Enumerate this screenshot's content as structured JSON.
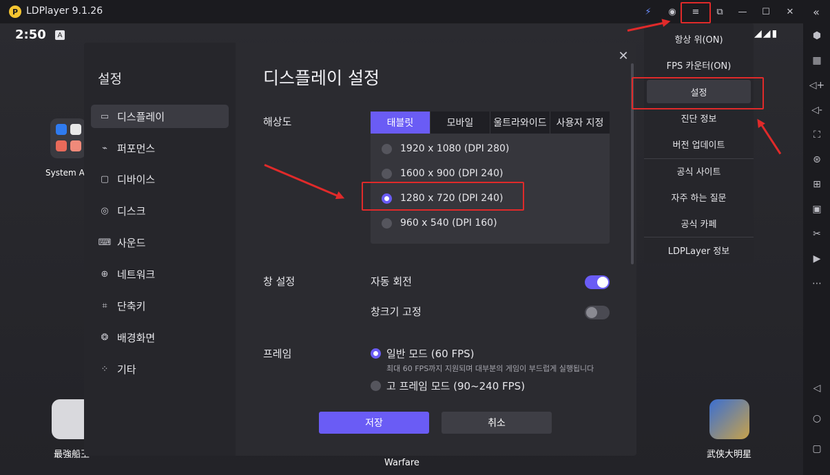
{
  "titlebar": {
    "title": "LDPlayer 9.1.26",
    "logo_text": "P"
  },
  "status": {
    "time": "2:50",
    "a_badge": "A",
    "signal": "◢◢▮"
  },
  "home": {
    "system_apps_label": "System Ap",
    "dock": [
      {
        "label": "最強船王"
      },
      {
        "label": "Warfare"
      },
      {
        "label": "武侠大明星"
      }
    ]
  },
  "settings": {
    "sidebar_title": "설정",
    "sidebar": [
      {
        "label": "디스플레이",
        "icon": "monitor-icon",
        "glyph": "▭"
      },
      {
        "label": "퍼포먼스",
        "icon": "performance-icon",
        "glyph": "⌁"
      },
      {
        "label": "디바이스",
        "icon": "device-icon",
        "glyph": "▢"
      },
      {
        "label": "디스크",
        "icon": "disk-icon",
        "glyph": "◎"
      },
      {
        "label": "사운드",
        "icon": "gamepad-icon",
        "glyph": "⌨"
      },
      {
        "label": "네트워크",
        "icon": "globe-icon",
        "glyph": "⊕"
      },
      {
        "label": "단축키",
        "icon": "keyboard-icon",
        "glyph": "⌗"
      },
      {
        "label": "배경화면",
        "icon": "palette-icon",
        "glyph": "❂"
      },
      {
        "label": "기타",
        "icon": "grid-icon",
        "glyph": "⁘"
      }
    ],
    "title": "디스플레이 설정",
    "close_glyph": "✕",
    "resolution": {
      "label": "해상도",
      "tabs": [
        {
          "label": "태블릿",
          "active": true
        },
        {
          "label": "모바일",
          "active": false
        },
        {
          "label": "울트라와이드",
          "active": false
        },
        {
          "label": "사용자 지정",
          "active": false
        }
      ],
      "options": [
        {
          "label": "1920 x 1080  (DPI 280)",
          "selected": false
        },
        {
          "label": "1600 x 900  (DPI 240)",
          "selected": false
        },
        {
          "label": "1280 x 720  (DPI 240)",
          "selected": true
        },
        {
          "label": "960 x 540  (DPI 160)",
          "selected": false
        }
      ]
    },
    "window": {
      "label": "창 설정",
      "auto_rotate": {
        "label": "자동 회전",
        "on": true
      },
      "fix_size": {
        "label": "창크기 고정",
        "on": false
      }
    },
    "frame": {
      "label": "프레임",
      "normal": {
        "label": "일반 모드 (60 FPS)",
        "selected": true
      },
      "normal_desc": "최대 60 FPS까지 지원되며 대부분의 게임이 부드럽게 실행됩니다",
      "high": {
        "label": "고 프레임 모드 (90~240 FPS)",
        "selected": false
      }
    },
    "save_label": "저장",
    "cancel_label": "취소"
  },
  "menu": {
    "items": [
      {
        "label": "항상 위(ON)"
      },
      {
        "label": "FPS 카운터(ON)"
      },
      {
        "label": "설정"
      },
      {
        "label": "진단 정보"
      },
      {
        "label": "버전 업데이트"
      },
      {
        "label": "공식 사이트"
      },
      {
        "label": "자주 하는 질문"
      },
      {
        "label": "공식 카페"
      },
      {
        "label": "LDPLayer 정보"
      }
    ]
  },
  "titlebar_icons": [
    {
      "name": "bolt-icon",
      "glyph": "⚡"
    },
    {
      "name": "account-icon",
      "glyph": "◉"
    },
    {
      "name": "menu-icon",
      "glyph": "≡"
    },
    {
      "name": "popout-icon",
      "glyph": "⧉"
    },
    {
      "name": "minimize-icon",
      "glyph": "—"
    },
    {
      "name": "maximize-icon",
      "glyph": "☐"
    },
    {
      "name": "close-icon",
      "glyph": "✕"
    },
    {
      "name": "collapse-icon",
      "glyph": "«"
    }
  ],
  "rail_icons": [
    {
      "name": "settings-gear-icon",
      "glyph": "⬢"
    },
    {
      "name": "keyboard-map-icon",
      "glyph": "▦"
    },
    {
      "name": "volume-up-icon",
      "glyph": "◁+"
    },
    {
      "name": "volume-down-icon",
      "glyph": "◁-"
    },
    {
      "name": "screenshot-icon",
      "glyph": "⛶"
    },
    {
      "name": "lock-icon",
      "glyph": "⊛"
    },
    {
      "name": "add-window-icon",
      "glyph": "⊞"
    },
    {
      "name": "apk-icon",
      "glyph": "▣"
    },
    {
      "name": "scissors-icon",
      "glyph": "✂"
    },
    {
      "name": "record-icon",
      "glyph": "▶"
    },
    {
      "name": "more-icon",
      "glyph": "⋯"
    },
    {
      "name": "back-icon",
      "glyph": "◁"
    },
    {
      "name": "home-icon",
      "glyph": "○"
    },
    {
      "name": "recents-icon",
      "glyph": "▢"
    }
  ],
  "colors": {
    "accent": "#6a5cf5",
    "annotation": "#e02a2a"
  }
}
